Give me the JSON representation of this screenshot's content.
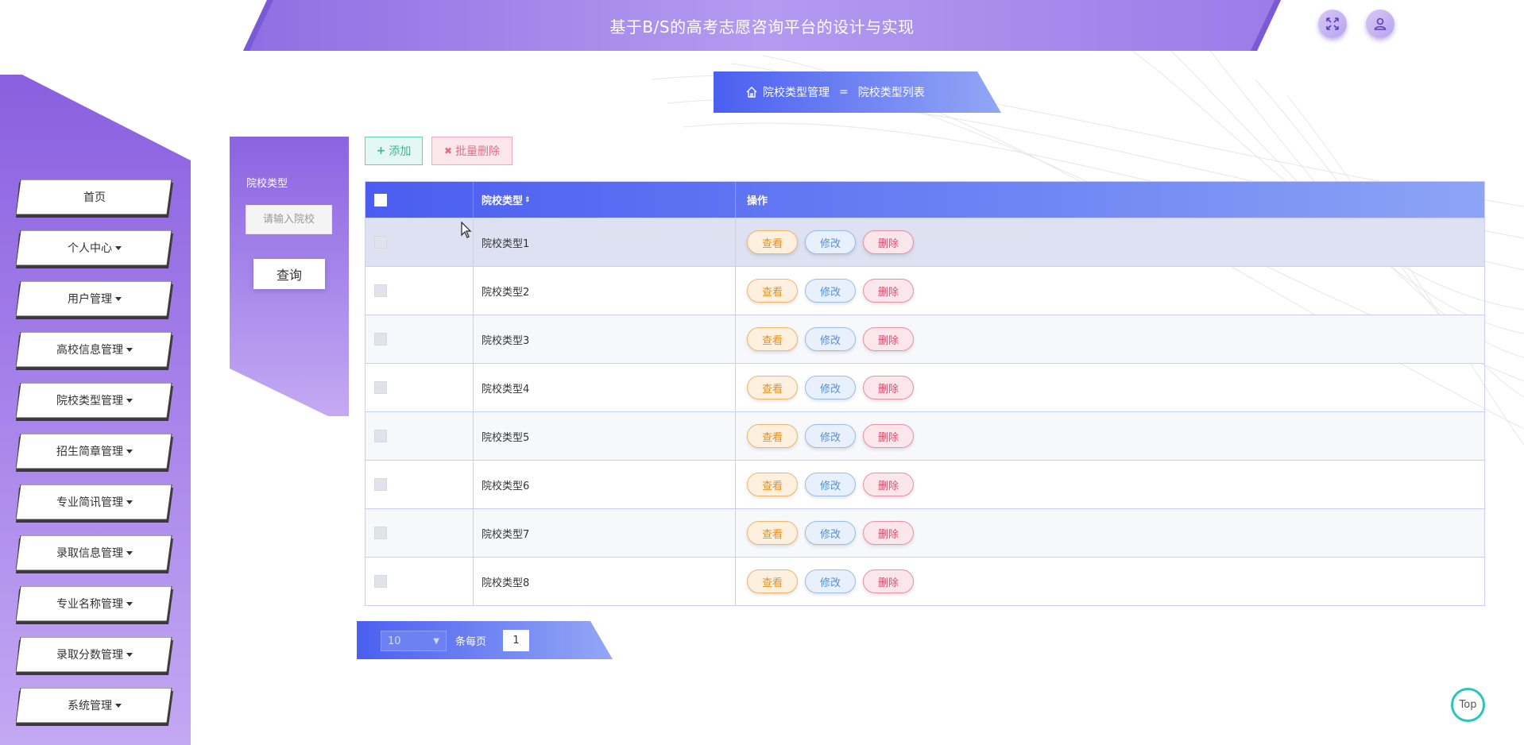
{
  "header": {
    "title": "基于B/S的高考志愿咨询平台的设计与实现",
    "fullscreen_icon": "fullscreen-icon",
    "user_icon": "user-icon"
  },
  "breadcrumb": {
    "home_icon": "home-icon",
    "parent": "院校类型管理",
    "separator": "=",
    "current": "院校类型列表"
  },
  "sidebar": {
    "items": [
      {
        "label": "首页",
        "has_caret": false
      },
      {
        "label": "个人中心",
        "has_caret": true
      },
      {
        "label": "用户管理",
        "has_caret": true
      },
      {
        "label": "高校信息管理",
        "has_caret": true
      },
      {
        "label": "院校类型管理",
        "has_caret": true
      },
      {
        "label": "招生简章管理",
        "has_caret": true
      },
      {
        "label": "专业简讯管理",
        "has_caret": true
      },
      {
        "label": "录取信息管理",
        "has_caret": true
      },
      {
        "label": "专业名称管理",
        "has_caret": true
      },
      {
        "label": "录取分数管理",
        "has_caret": true
      },
      {
        "label": "系统管理",
        "has_caret": true
      }
    ]
  },
  "search": {
    "label": "院校类型",
    "placeholder": "请输入院校",
    "button": "查询"
  },
  "actions": {
    "add": "添加",
    "batch_delete": "批量删除"
  },
  "table": {
    "headers": [
      "院校类型",
      "操作"
    ],
    "sort_icon": "sort-icon",
    "rows": [
      {
        "type": "院校类型1"
      },
      {
        "type": "院校类型2"
      },
      {
        "type": "院校类型3"
      },
      {
        "type": "院校类型4"
      },
      {
        "type": "院校类型5"
      },
      {
        "type": "院校类型6"
      },
      {
        "type": "院校类型7"
      },
      {
        "type": "院校类型8"
      }
    ],
    "row_actions": {
      "view": "查看",
      "edit": "修改",
      "delete": "删除"
    }
  },
  "pagination": {
    "page_size": "10",
    "per_page_label": "条每页",
    "current_page": "1"
  },
  "top_button": "Top",
  "colors": {
    "primary_purple": "#8b6be6",
    "table_header_blue": "#4a5df0",
    "add_green": "#36b899",
    "delete_red": "#d65270",
    "view_orange": "#e0932b",
    "edit_blue": "#5a8fcf"
  }
}
